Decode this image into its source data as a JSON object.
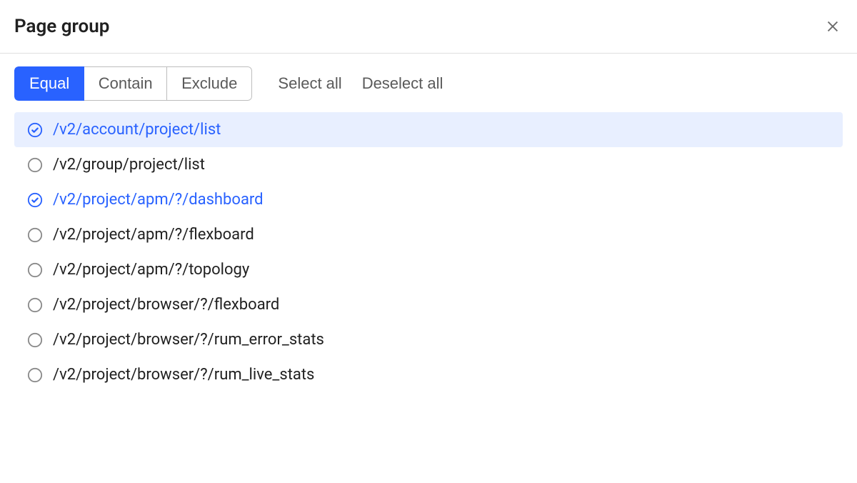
{
  "header": {
    "title": "Page group"
  },
  "toolbar": {
    "segments": [
      {
        "label": "Equal",
        "active": true
      },
      {
        "label": "Contain",
        "active": false
      },
      {
        "label": "Exclude",
        "active": false
      }
    ],
    "select_all_label": "Select all",
    "deselect_all_label": "Deselect all"
  },
  "list": {
    "items": [
      {
        "path": "/v2/account/project/list",
        "selected": true,
        "highlight": true
      },
      {
        "path": "/v2/group/project/list",
        "selected": false,
        "highlight": false
      },
      {
        "path": "/v2/project/apm/?/dashboard",
        "selected": true,
        "highlight": false
      },
      {
        "path": "/v2/project/apm/?/flexboard",
        "selected": false,
        "highlight": false
      },
      {
        "path": "/v2/project/apm/?/topology",
        "selected": false,
        "highlight": false
      },
      {
        "path": "/v2/project/browser/?/flexboard",
        "selected": false,
        "highlight": false
      },
      {
        "path": "/v2/project/browser/?/rum_error_stats",
        "selected": false,
        "highlight": false
      },
      {
        "path": "/v2/project/browser/?/rum_live_stats",
        "selected": false,
        "highlight": false
      }
    ]
  }
}
